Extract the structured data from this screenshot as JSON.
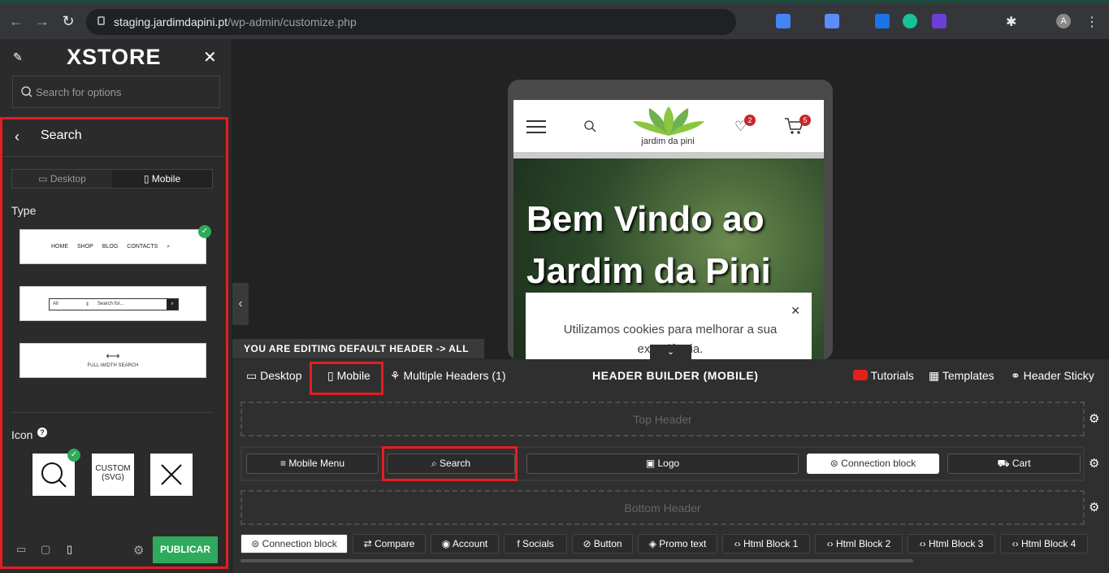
{
  "browser": {
    "url_domain": "staging.jardimdapini.pt",
    "url_path": "/wp-admin/customize.php"
  },
  "sidebar": {
    "logo": "XSTORE",
    "search_placeholder": "Search for options",
    "panel_title": "Search",
    "tab_desktop": "Desktop",
    "tab_mobile": "Mobile",
    "type_label": "Type",
    "icon_label": "Icon",
    "publish": "PUBLICAR",
    "type_menu": [
      "HOME",
      "SHOP",
      "BLOG",
      "CONTACTS"
    ],
    "type_select": "All",
    "type_input": "Search for...",
    "type_full": "FULL-WIDTH SEARCH",
    "icon_custom": "CUSTOM (SVG)"
  },
  "preview": {
    "logo_text": "jardim da pini",
    "wishlist_count": "2",
    "cart_count": "5",
    "hero_line1": "Bem Vindo ao",
    "hero_line2": "Jardim da Pini",
    "cookie_text": "Utilizamos cookies para melhorar a sua experiência."
  },
  "builder": {
    "editing_notice": "YOU ARE EDITING DEFAULT HEADER -> ALL SITE",
    "desktop": "Desktop",
    "mobile": "Mobile",
    "multiple": "Multiple Headers (1)",
    "title": "HEADER BUILDER (MOBILE)",
    "tutorials": "Tutorials",
    "templates": "Templates",
    "sticky": "Header Sticky",
    "top_header": "Top Header",
    "bottom_header": "Bottom Header",
    "slots": [
      "Mobile Menu",
      "Search",
      "Logo",
      "Connection block",
      "Cart"
    ],
    "elements": [
      "Connection block",
      "Compare",
      "Account",
      "Socials",
      "Button",
      "Promo text",
      "Html Block 1",
      "Html Block 2",
      "Html Block 3",
      "Html Block 4"
    ]
  }
}
